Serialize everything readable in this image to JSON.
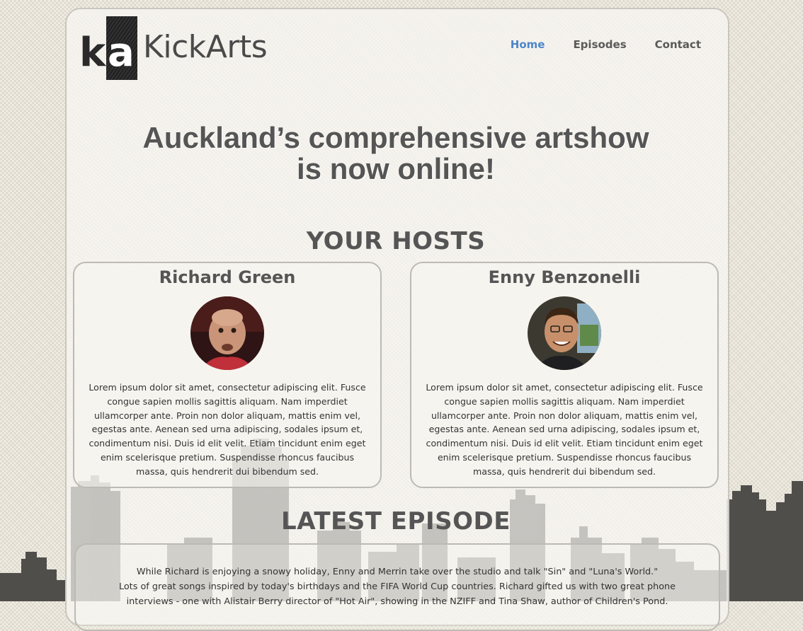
{
  "site": {
    "logo_text": "KickArts",
    "logo_mark": "ka"
  },
  "nav": {
    "items": [
      {
        "label": "Home",
        "active": true
      },
      {
        "label": "Episodes",
        "active": false
      },
      {
        "label": "Contact",
        "active": false
      }
    ]
  },
  "hero": {
    "line1": "Auckland’s comprehensive artshow",
    "line2": "is now online!"
  },
  "hosts": {
    "title": "YOUR HOSTS",
    "items": [
      {
        "name": "Richard Green",
        "bio": "Lorem ipsum dolor sit amet, consectetur adipiscing elit. Fusce congue sapien mollis sagittis aliquam. Nam imperdiet ullamcorper ante. Proin non dolor aliquam, mattis enim vel, egestas ante. Aenean sed urna adipiscing, sodales ipsum et, condimentum nisi. Duis id elit velit. Etiam tincidunt enim eget enim scelerisque pretium. Suspendisse rhoncus faucibus massa, quis hendrerit dui bibendum sed."
      },
      {
        "name": "Enny Benzonelli",
        "bio": "Lorem ipsum dolor sit amet, consectetur adipiscing elit. Fusce congue sapien mollis sagittis aliquam. Nam imperdiet ullamcorper ante. Proin non dolor aliquam, mattis enim vel, egestas ante. Aenean sed urna adipiscing, sodales ipsum et, condimentum nisi. Duis id elit velit. Etiam tincidunt enim eget enim scelerisque pretium. Suspendisse rhoncus faucibus massa, quis hendrerit dui bibendum sed."
      }
    ]
  },
  "episode": {
    "title": "LATEST EPISODE",
    "line1": "While Richard is enjoying a snowy holiday, Enny and Merrin take over the studio and talk \"Sin\" and \"Luna's World.\"",
    "line2": "Lots of great songs inspired by today's birthdays and the FIFA World Cup countries. Richard gifted us with two great phone",
    "line3": "interviews - one with Alistair Berry director of \"Hot Air\", showing in the NZIFF and Tina Shaw, author of Children's Pond."
  },
  "colors": {
    "nav_active": "#4d86c9",
    "text": "#555555",
    "skyline": "#4f4e4b"
  }
}
